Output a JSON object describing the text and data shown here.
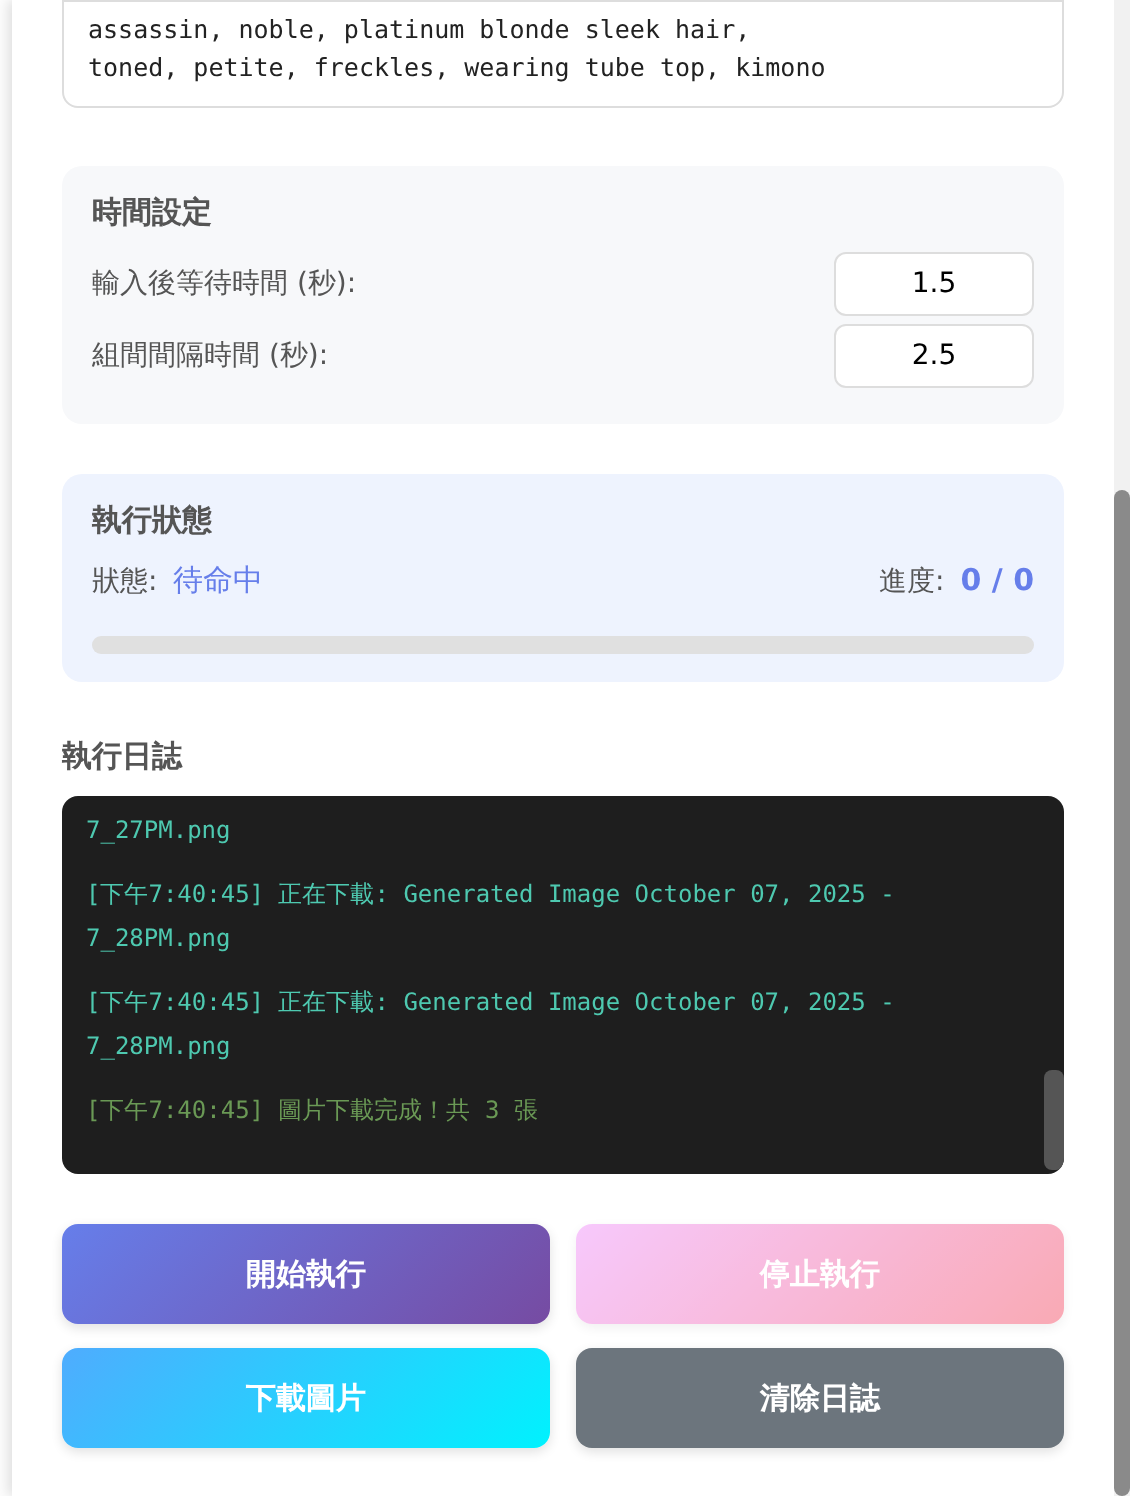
{
  "prompt": {
    "value": "assassin, noble, platinum blonde sleek hair,\ntoned, petite, freckles, wearing tube top, kimono"
  },
  "timing": {
    "title": "時間設定",
    "fields": [
      {
        "label": "輸入後等待時間 (秒):",
        "value": "1.5"
      },
      {
        "label": "組間間隔時間 (秒):",
        "value": "2.5"
      }
    ]
  },
  "status": {
    "title": "執行狀態",
    "state_label": "狀態:",
    "state": "待命中",
    "progress_label": "進度:",
    "progress": "0 / 0",
    "level": 0
  },
  "log": {
    "title": "執行日誌",
    "entries": [
      {
        "kind": "info",
        "text": "7_27PM.png"
      },
      {
        "kind": "info",
        "text": "[下午7:40:45] 正在下載: Generated Image October 07, 2025 - 7_28PM.png"
      },
      {
        "kind": "info",
        "text": "[下午7:40:45] 正在下載: Generated Image October 07, 2025 - 7_28PM.png"
      },
      {
        "kind": "success",
        "text": "[下午7:40:45] 圖片下載完成！共 3 張"
      }
    ]
  },
  "buttons": [
    {
      "kind": "start",
      "label": "開始執行",
      "disabled": false
    },
    {
      "kind": "stop",
      "label": "停止執行",
      "disabled": true
    },
    {
      "kind": "download",
      "label": "下載圖片",
      "disabled": false
    },
    {
      "kind": "clear",
      "label": "清除日誌",
      "disabled": false
    }
  ]
}
